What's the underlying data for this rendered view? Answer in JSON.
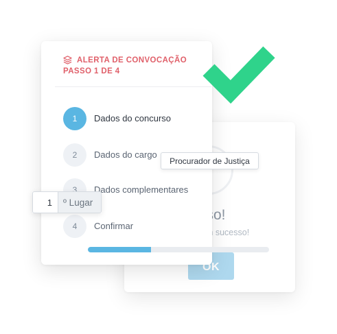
{
  "success_modal": {
    "title": "sso!",
    "subtitle": "om sucesso!",
    "ok_label": "OK"
  },
  "wizard": {
    "header": "ALERTA DE CONVOCAÇÃO",
    "step_indicator": "PASSO 1 DE 4",
    "steps": [
      {
        "number": "1",
        "label": "Dados do concurso",
        "active": true
      },
      {
        "number": "2",
        "label": "Dados do cargo",
        "active": false
      },
      {
        "number": "3",
        "label": "Dados complementares",
        "active": false
      },
      {
        "number": "4",
        "label": "Confirmar",
        "active": false
      }
    ],
    "progress": 0.35
  },
  "tooltip": {
    "text": "Procurador de Justiça"
  },
  "placement": {
    "value": "1",
    "suffix": "º Lugar"
  },
  "colors": {
    "accent": "#5ab6e2",
    "alert_red": "#e0606a",
    "check_green": "#2fd38b"
  },
  "icons": {
    "header": "layers-icon",
    "decoration": "checkmark-icon"
  }
}
